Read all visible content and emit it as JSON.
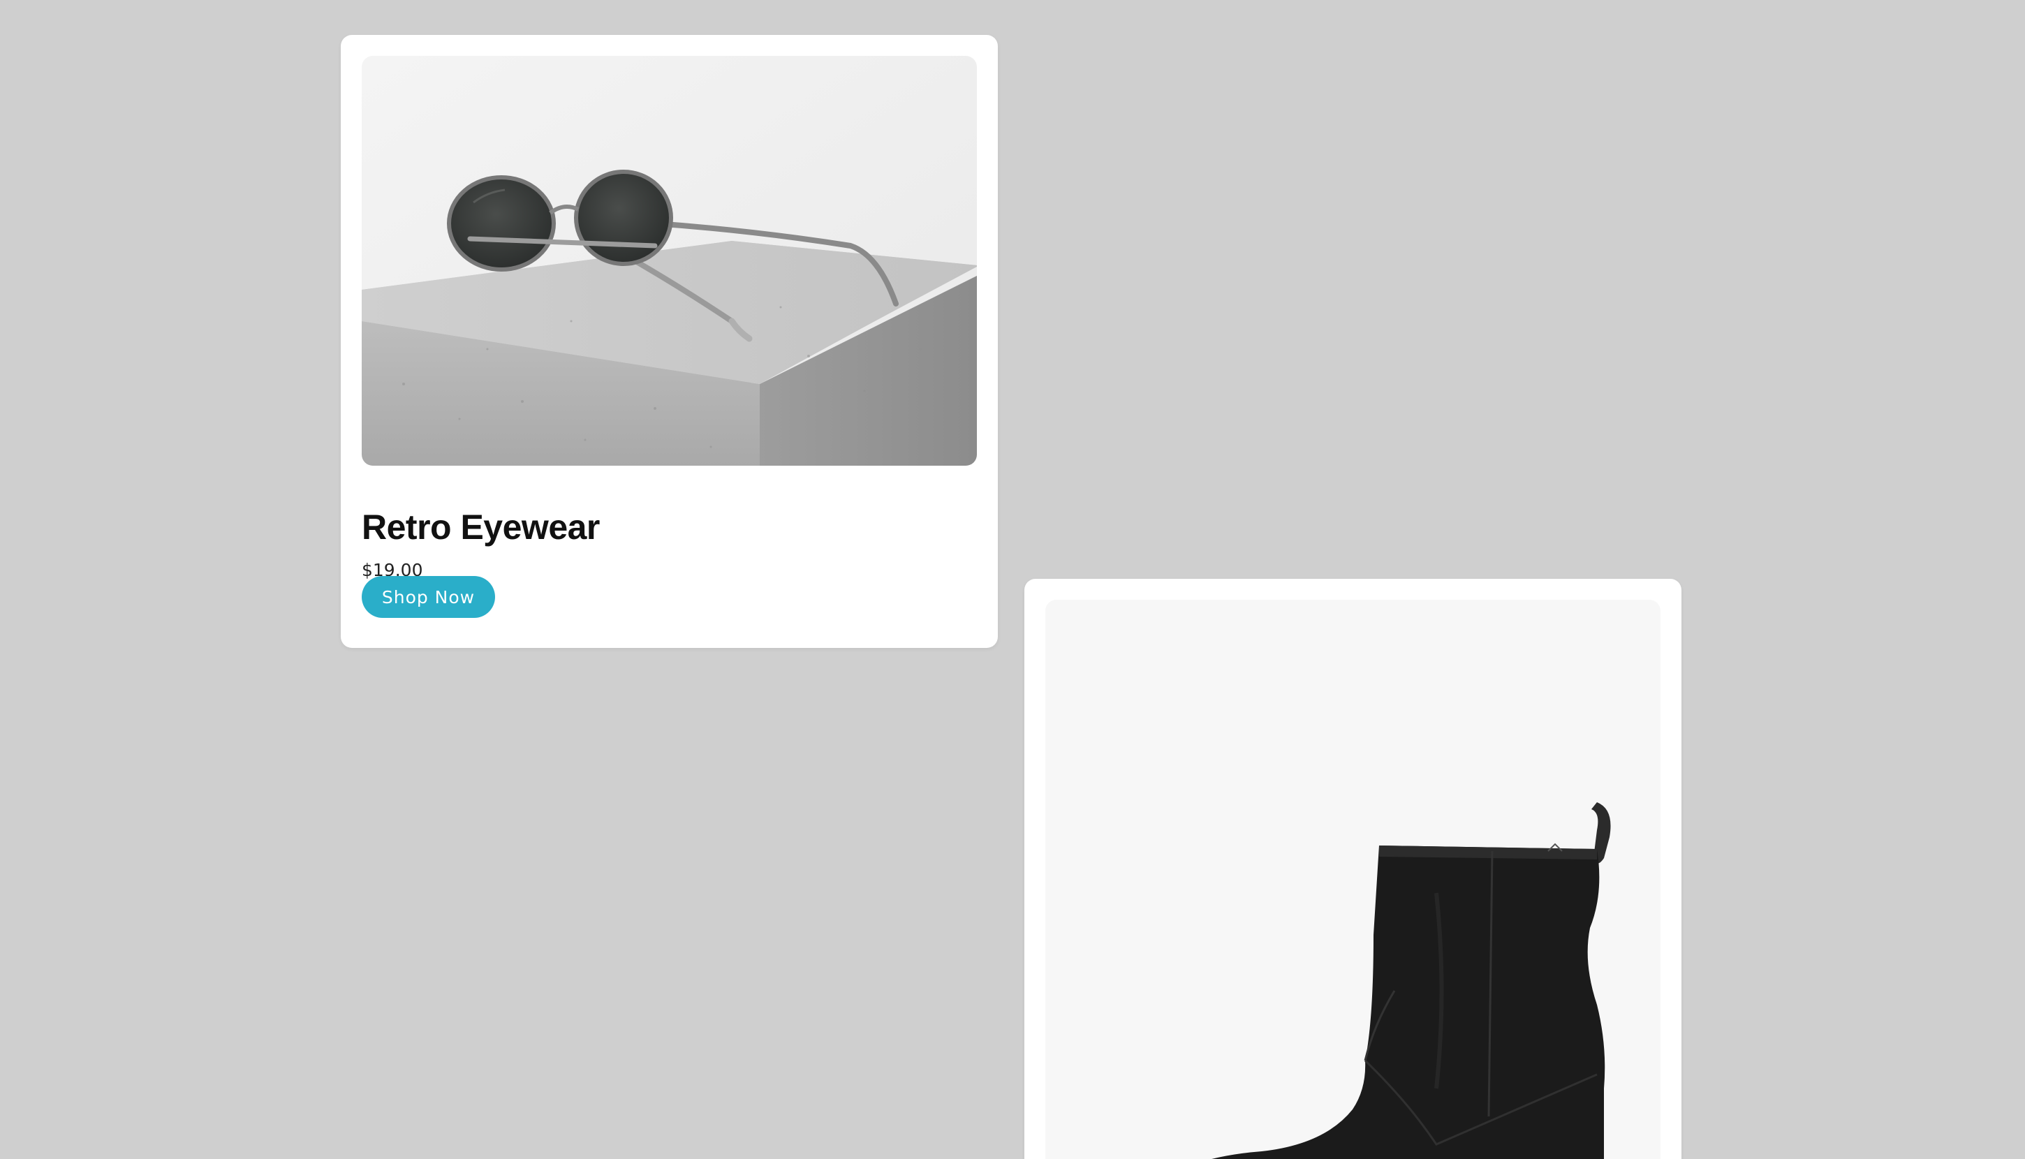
{
  "colors": {
    "background": "#cfcfcf",
    "card": "#ffffff",
    "accent": "#2aaec9"
  },
  "products": [
    {
      "title": "Retro Eyewear",
      "price": "$19.00",
      "cta": "Shop Now",
      "image": "sunglasses-on-concrete-block"
    },
    {
      "image": "black-leather-ankle-boot"
    }
  ]
}
